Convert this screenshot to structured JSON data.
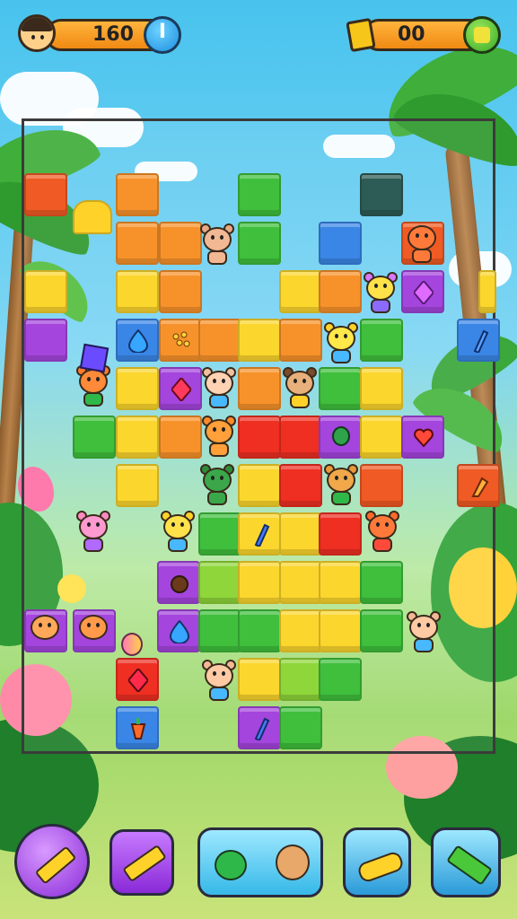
{
  "hud": {
    "score": "160",
    "score_button_icon": "I",
    "coins": "00",
    "avatar_icon": "player-avatar",
    "coin_icon": "gold-card-icon",
    "add_button_icon": "green-plus-icon"
  },
  "board": {
    "colors": {
      "orange": "#f7922a",
      "yellow": "#fbd62d",
      "green": "#3fbf3c",
      "red": "#ee2f22",
      "blue": "#3a86e6",
      "purple": "#a445dd"
    }
  },
  "boosters": [
    {
      "name": "hammer-booster",
      "icon": "yellow-hammer-icon"
    },
    {
      "name": "double-hammer-booster",
      "icon": "double-hammer-icon"
    },
    {
      "name": "critter-swap-booster",
      "icon": "critter-swap-icon"
    },
    {
      "name": "banana-booster",
      "icon": "banana-icon"
    },
    {
      "name": "mallet-booster",
      "icon": "green-mallet-icon"
    }
  ]
}
